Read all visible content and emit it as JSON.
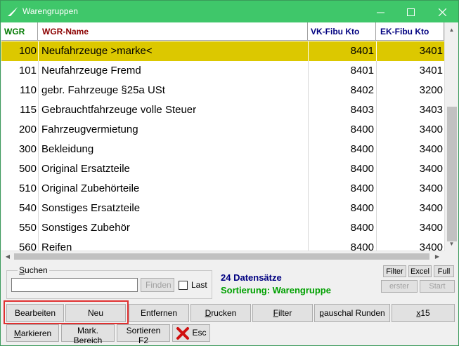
{
  "window": {
    "title": "Warengruppen"
  },
  "columns": [
    "WGR",
    "WGR-Name",
    "VK-Fibu Kto",
    "EK-Fibu Kto"
  ],
  "rows": [
    {
      "wgr": "100",
      "name": "Neufahrzeuge >marke<",
      "vk": "8401",
      "ek": "3401",
      "selected": true
    },
    {
      "wgr": "101",
      "name": "Neufahrzeuge Fremd",
      "vk": "8401",
      "ek": "3401"
    },
    {
      "wgr": "110",
      "name": "gebr. Fahrzeuge §25a USt",
      "vk": "8402",
      "ek": "3200"
    },
    {
      "wgr": "115",
      "name": "Gebrauchtfahrzeuge volle Steuer",
      "vk": "8403",
      "ek": "3403"
    },
    {
      "wgr": "200",
      "name": "Fahrzeugvermietung",
      "vk": "8400",
      "ek": "3400"
    },
    {
      "wgr": "300",
      "name": "Bekleidung",
      "vk": "8400",
      "ek": "3400"
    },
    {
      "wgr": "500",
      "name": "Original Ersatzteile",
      "vk": "8400",
      "ek": "3400"
    },
    {
      "wgr": "510",
      "name": "Original Zubehörteile",
      "vk": "8400",
      "ek": "3400"
    },
    {
      "wgr": "540",
      "name": "Sonstiges Ersatzteile",
      "vk": "8400",
      "ek": "3400"
    },
    {
      "wgr": "550",
      "name": "Sonstiges Zubehör",
      "vk": "8400",
      "ek": "3400"
    },
    {
      "wgr": "560",
      "name": "Reifen",
      "vk": "8400",
      "ek": "3400"
    }
  ],
  "search": {
    "legend": "Suchen",
    "value": "",
    "find_button": "Finden",
    "last_label": "Last",
    "last_checked": false
  },
  "info": {
    "count": "24 Datensätze",
    "sort": "Sortierung: Warengruppe"
  },
  "small_buttons": {
    "filter": "Filter",
    "excel": "Excel",
    "full": "Full",
    "first": "erster",
    "start": "Start"
  },
  "buttons_row1": {
    "edit": "Bearbeiten",
    "new": "Neu",
    "remove": "Entfernen",
    "print": "Drucken",
    "filter": "Filter",
    "round": "pauschal Runden",
    "x15": "x15"
  },
  "buttons_row2": {
    "mark": "Markieren",
    "mark_range": "Mark. Bereich",
    "sort": "Sortieren F2",
    "esc": "Esc"
  },
  "colors": {
    "titlebar": "#3fc76a",
    "selected_row": "#dcc800",
    "count_text": "#000080",
    "sort_text": "#00a000",
    "highlight_outline": "#e03030"
  }
}
